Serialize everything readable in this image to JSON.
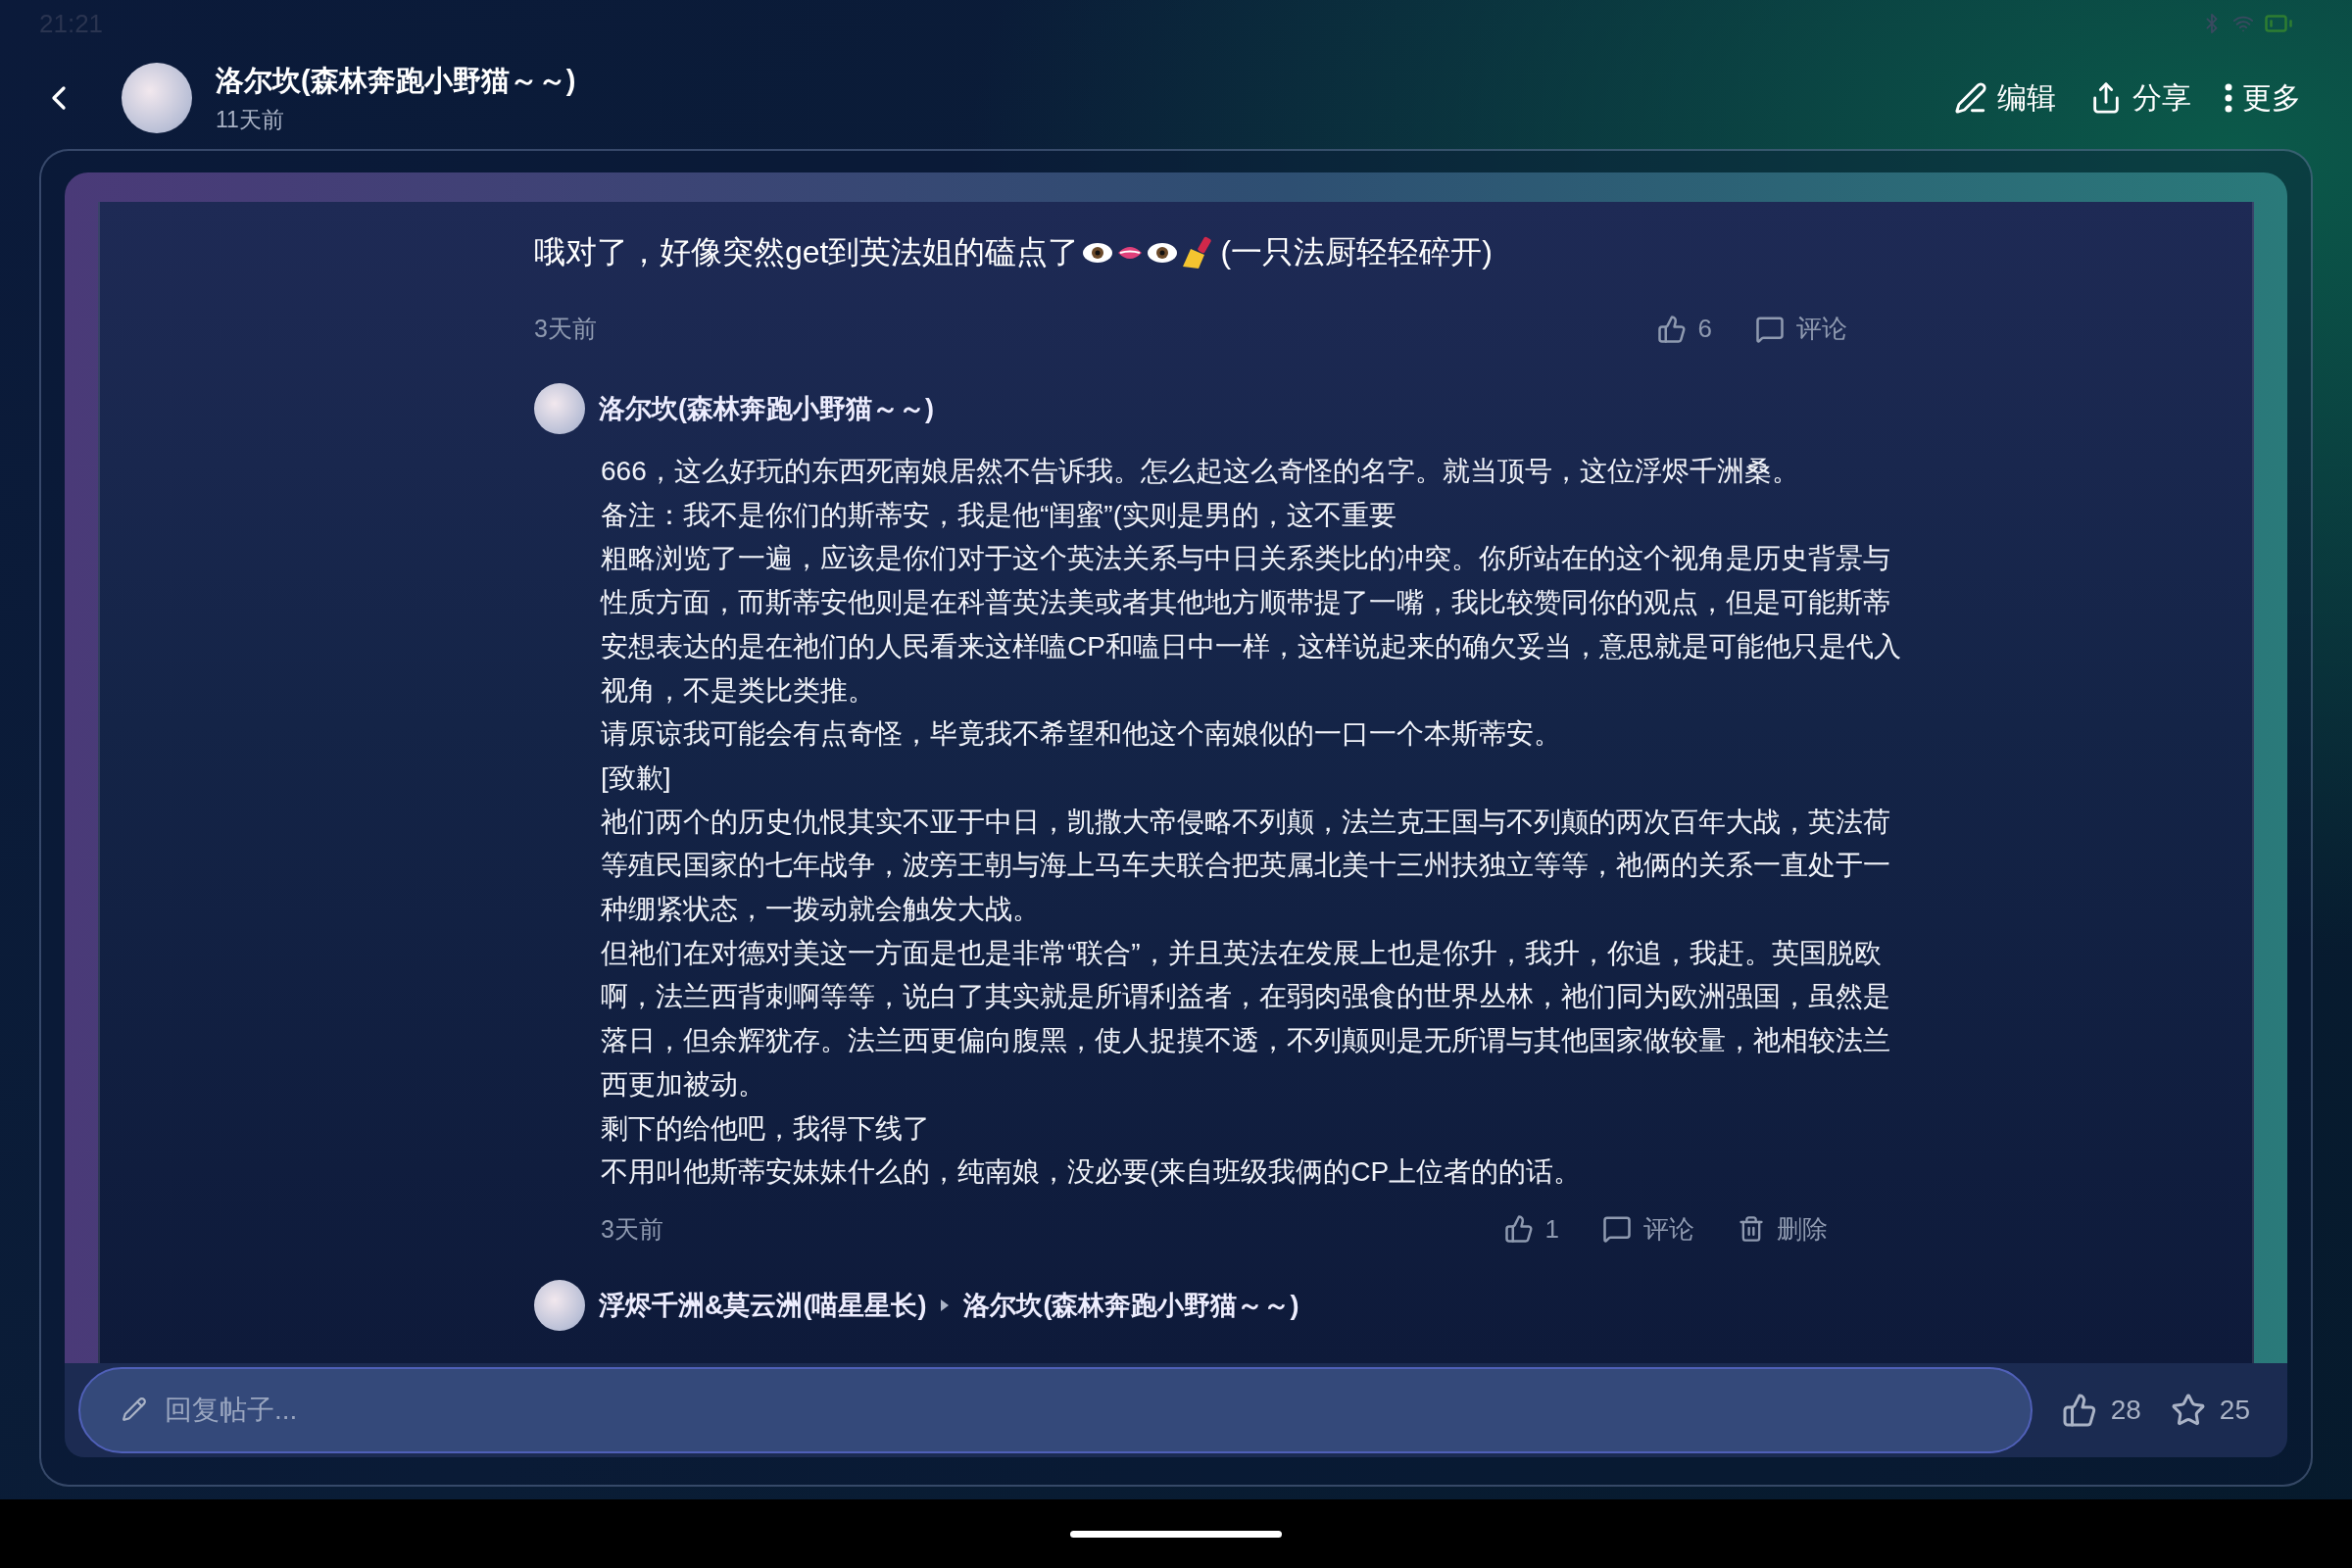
{
  "status_bar": {
    "time": "21:21"
  },
  "header": {
    "author": "洛尔坎(森林奔跑小野猫～～)",
    "time": "11天前",
    "actions": [
      {
        "kind": "edit",
        "label": "编辑"
      },
      {
        "kind": "share",
        "label": "分享"
      },
      {
        "kind": "more",
        "label": "更多"
      }
    ]
  },
  "post": {
    "text_before": "哦对了，好像突然get到英法姐的磕点了",
    "text_after": "(一只法厨轻轻碎开)",
    "time": "3天前",
    "likes": "6",
    "comment_label": "评论"
  },
  "comments": [
    {
      "author": "洛尔坎(森林奔跑小野猫～～)",
      "paragraphs": [
        "666，这么好玩的东西死南娘居然不告诉我。怎么起这么奇怪的名字。就当顶号，这位浮烬千洲桑。",
        "备注：我不是你们的斯蒂安，我是他“闺蜜”(实则是男的，这不重要",
        "粗略浏览了一遍，应该是你们对于这个英法关系与中日关系类比的冲突。你所站在的这个视角是历史背景与性质方面，而斯蒂安他则是在科普英法美或者其他地方顺带提了一嘴，我比较赞同你的观点，但是可能斯蒂安想表达的是在祂们的人民看来这样嗑CP和嗑日中一样，这样说起来的确欠妥当，意思就是可能他只是代入视角，不是类比类推。",
        "请原谅我可能会有点奇怪，毕竟我不希望和他这个南娘似的一口一个本斯蒂安。",
        "[致歉]",
        "祂们两个的历史仇恨其实不亚于中日，凯撒大帝侵略不列颠，法兰克王国与不列颠的两次百年大战，英法荷等殖民国家的七年战争，波旁王朝与海上马车夫联合把英属北美十三州扶独立等等，祂俩的关系一直处于一种绷紧状态，一拨动就会触发大战。",
        "但祂们在对德对美这一方面是也是非常“联合”，并且英法在发展上也是你升，我升，你追，我赶。英国脱欧啊，法兰西背刺啊等等，说白了其实就是所谓利益者，在弱肉强食的世界丛林，祂们同为欧洲强国，虽然是落日，但余辉犹存。法兰西更偏向腹黑，使人捉摸不透，不列颠则是无所谓与其他国家做较量，祂相较法兰西更加被动。",
        "剩下的给他吧，我得下线了",
        "不用叫他斯蒂安妹妹什么的，纯南娘，没必要(来自班级我俩的CP上位者的的话。"
      ],
      "time": "3天前",
      "likes": "1",
      "actions": [
        {
          "kind": "comment",
          "label": "评论"
        },
        {
          "kind": "delete",
          "label": "删除"
        }
      ]
    },
    {
      "author": "浮烬千洲&莫云洲(喵星星长)",
      "reply_to": "洛尔坎(森林奔跑小野猫～～)"
    }
  ],
  "reply_bar": {
    "placeholder": "回复帖子...",
    "likes": "28",
    "favorites": "25"
  }
}
